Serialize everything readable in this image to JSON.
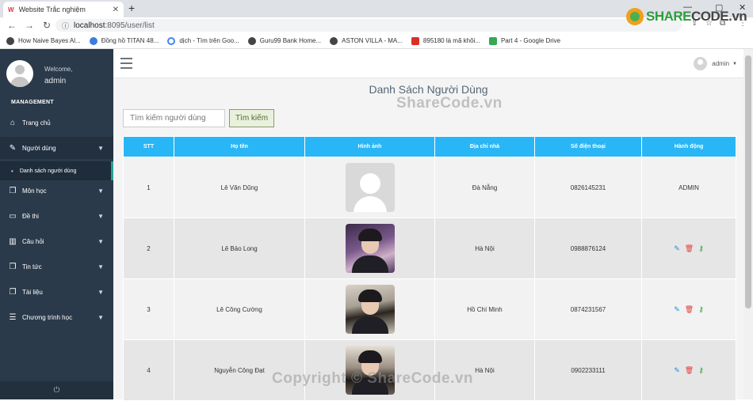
{
  "browser": {
    "tab_title": "Website Trắc nghiệm",
    "tab_favicon": "W",
    "url_host": "localhost",
    "url_path": ":8095/user/list",
    "bookmarks": [
      {
        "label": "How Naive Bayes Al..."
      },
      {
        "label": "Đồng hồ TITAN 48..."
      },
      {
        "label": "dịch - Tìm trên Goo..."
      },
      {
        "label": "Guru99 Bank Home..."
      },
      {
        "label": "ASTON VILLA - MA..."
      },
      {
        "label": "895180 là mã khôi..."
      },
      {
        "label": "Part 4 - Google Drive"
      }
    ]
  },
  "logo": {
    "share": "SHARE",
    "code": "CODE.vn"
  },
  "sidebar": {
    "welcome": "Welcome,",
    "username": "admin",
    "section": "MANAGEMENT",
    "items": [
      {
        "label": "Trang chủ",
        "icon": "home-icon"
      },
      {
        "label": "Người dùng",
        "icon": "edit-icon"
      },
      {
        "label": "Môn học",
        "icon": "copy-icon"
      },
      {
        "label": "Đề thi",
        "icon": "desktop-icon"
      },
      {
        "label": "Câu hỏi",
        "icon": "bar-chart-icon"
      },
      {
        "label": "Tin tức",
        "icon": "copy-icon"
      },
      {
        "label": "Tài liệu",
        "icon": "copy-icon"
      },
      {
        "label": "Chương trình học",
        "icon": "list-icon"
      }
    ],
    "subitem": "Danh sách người dùng"
  },
  "topbar": {
    "user": "admin"
  },
  "page": {
    "title": "Danh Sách Người Dùng",
    "search_placeholder": "Tìm kiếm người dùng",
    "search_button": "Tìm kiếm"
  },
  "table": {
    "headers": [
      "STT",
      "Họ tên",
      "Hình ảnh",
      "Địa chỉ nhà",
      "Số điện thoại",
      "Hành động"
    ],
    "rows": [
      {
        "stt": "1",
        "name": "Lê Văn Dũng",
        "address": "Đà Nẵng",
        "phone": "0826145231",
        "action": "ADMIN"
      },
      {
        "stt": "2",
        "name": "Lê Bảo Long",
        "address": "Hà Nội",
        "phone": "0988876124",
        "action": ""
      },
      {
        "stt": "3",
        "name": "Lê Công Cường",
        "address": "Hồ Chí Minh",
        "phone": "0874231567",
        "action": ""
      },
      {
        "stt": "4",
        "name": "Nguyễn Công Đạt",
        "address": "Hà Nội",
        "phone": "0902233111",
        "action": ""
      }
    ]
  },
  "watermarks": {
    "top": "ShareCode.vn",
    "bottom": "Copyright © ShareCode.vn"
  },
  "colors": {
    "sidebar": "#2b3a4a",
    "table_header": "#29b6f6",
    "accent": "#22a398"
  }
}
